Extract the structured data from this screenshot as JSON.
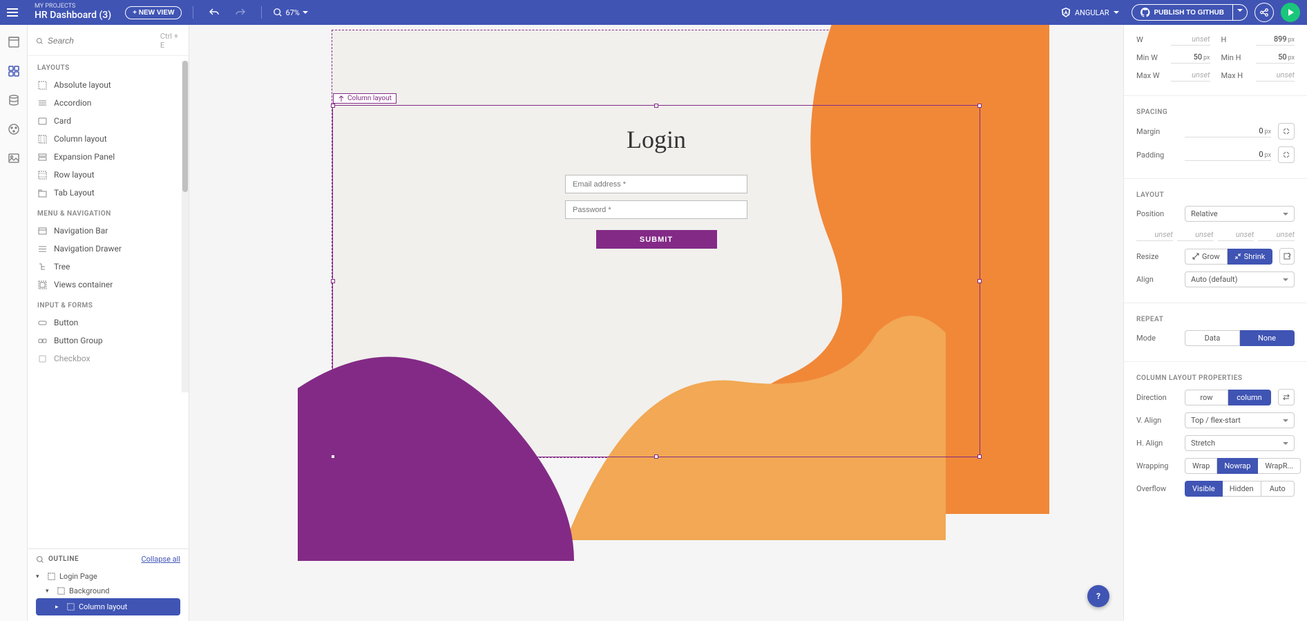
{
  "header": {
    "my_projects": "MY PROJECTS",
    "project_name": "HR Dashboard (3)",
    "new_view": "+ NEW VIEW",
    "zoom": "67%",
    "framework": "ANGULAR",
    "publish": "PUBLISH TO GITHUB"
  },
  "search": {
    "placeholder": "Search",
    "hint": "Ctrl + E"
  },
  "categories": {
    "layouts": "LAYOUTS",
    "menu_nav": "MENU & NAVIGATION",
    "input_forms": "INPUT & FORMS"
  },
  "components": {
    "absolute_layout": "Absolute layout",
    "accordion": "Accordion",
    "card": "Card",
    "column_layout": "Column layout",
    "expansion_panel": "Expansion Panel",
    "row_layout": "Row layout",
    "tab_layout": "Tab Layout",
    "navigation_bar": "Navigation Bar",
    "navigation_drawer": "Navigation Drawer",
    "tree": "Tree",
    "views_container": "Views container",
    "button": "Button",
    "button_group": "Button Group",
    "checkbox": "Checkbox"
  },
  "outline": {
    "title": "OUTLINE",
    "collapse": "Collapse all",
    "login_page": "Login Page",
    "background": "Background",
    "column_layout": "Column layout"
  },
  "canvas": {
    "selection_label": "Column layout",
    "login_title": "Login",
    "email_placeholder": "Email address *",
    "password_placeholder": "Password *",
    "submit": "SUBMIT"
  },
  "props": {
    "w_label": "W",
    "w_val": "unset",
    "h_label": "H",
    "h_val": "899",
    "h_unit": "px",
    "minw_label": "Min W",
    "minw_val": "50",
    "minw_unit": "px",
    "minh_label": "Min H",
    "minh_val": "50",
    "minh_unit": "px",
    "maxw_label": "Max W",
    "maxw_val": "unset",
    "maxh_label": "Max H",
    "maxh_val": "unset",
    "spacing_title": "SPACING",
    "margin_label": "Margin",
    "margin_val": "0",
    "margin_unit": "px",
    "padding_label": "Padding",
    "padding_val": "0",
    "padding_unit": "px",
    "layout_title": "LAYOUT",
    "position_label": "Position",
    "position_val": "Relative",
    "pos_top": "unset",
    "pos_right": "unset",
    "pos_bottom": "unset",
    "pos_left": "unset",
    "resize_label": "Resize",
    "grow": "Grow",
    "shrink": "Shrink",
    "align_label": "Align",
    "align_val": "Auto (default)",
    "repeat_title": "REPEAT",
    "mode_label": "Mode",
    "data": "Data",
    "none": "None",
    "col_props_title": "COLUMN LAYOUT PROPERTIES",
    "direction_label": "Direction",
    "row": "row",
    "column": "column",
    "valign_label": "V. Align",
    "valign_val": "Top / flex-start",
    "halign_label": "H. Align",
    "halign_val": "Stretch",
    "wrapping_label": "Wrapping",
    "wrap": "Wrap",
    "nowrap": "Nowrap",
    "wrapr": "WrapR...",
    "overflow_label": "Overflow",
    "visible": "Visible",
    "hidden": "Hidden",
    "auto_ov": "Auto"
  },
  "help": "?"
}
